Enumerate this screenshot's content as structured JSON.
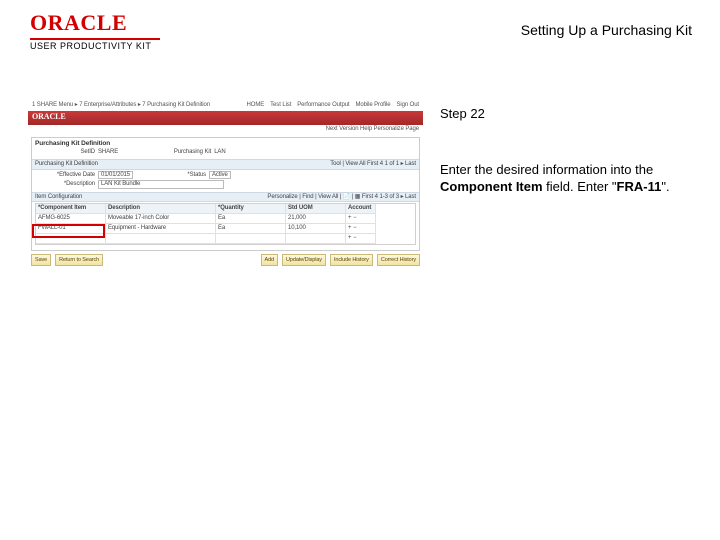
{
  "header": {
    "logo_text": "ORACLE",
    "logo_sub": "USER PRODUCTIVITY KIT",
    "page_title": "Setting Up a Purchasing Kit"
  },
  "instruction": {
    "step_label": "Step 22",
    "body_prefix": "Enter the desired information into the ",
    "body_bold1": "Component Item",
    "body_mid": " field. Enter \"",
    "body_bold2": "FRA-11",
    "body_suffix": "\"."
  },
  "screenshot": {
    "crumb_left": "1 SHARE   Menu ▸ 7 Enterprise/Attributes ▸ 7 Purchasing Kit Definition",
    "crumb_right": [
      "HOME",
      "Test List",
      "Performance Output",
      "Mobile Profile",
      "Sign Out"
    ],
    "brand": "ORACLE",
    "subbar": "Next Version  Help  Personalize Page",
    "box_title": "Purchasing Kit Definition",
    "row1": {
      "lbl1": "SetID",
      "val1": "SHARE",
      "lbl2": "Purchasing Kit",
      "val2": "LAN"
    },
    "bar1_left": "Purchasing Kit Definition",
    "bar1_right": "Tool | View All     First  4 1 of 1 ▸  Last",
    "row2": {
      "lbl1": "*Effective Date",
      "val1": "01/01/2015",
      "lbl2": "*Status",
      "val2": "Active"
    },
    "row3": {
      "lbl": "*Description",
      "val": "LAN Kit Bundle"
    },
    "bar2_left": "Item Configuration",
    "bar2_right": "Personalize | Find | View All | 📄 | ▦     First  4 1-3 of 3 ▸  Last",
    "grid": {
      "headers": [
        "*Component Item",
        "Description",
        "*Quantity",
        "Std UOM",
        "Account"
      ],
      "rows": [
        [
          "AFMG-6025",
          "Moveable 17-inch Color",
          "Ea",
          "21,000",
          "+  −"
        ],
        [
          "FWALL-01",
          "Equipment - Hardware",
          "Ea",
          "10,100",
          "+  −"
        ],
        [
          "",
          "",
          "",
          "",
          "+  −"
        ]
      ]
    },
    "footer_left": [
      "Save",
      "Return to Search"
    ],
    "footer_right": [
      "Add",
      "Update/Display",
      "Include History",
      "Correct History"
    ]
  }
}
